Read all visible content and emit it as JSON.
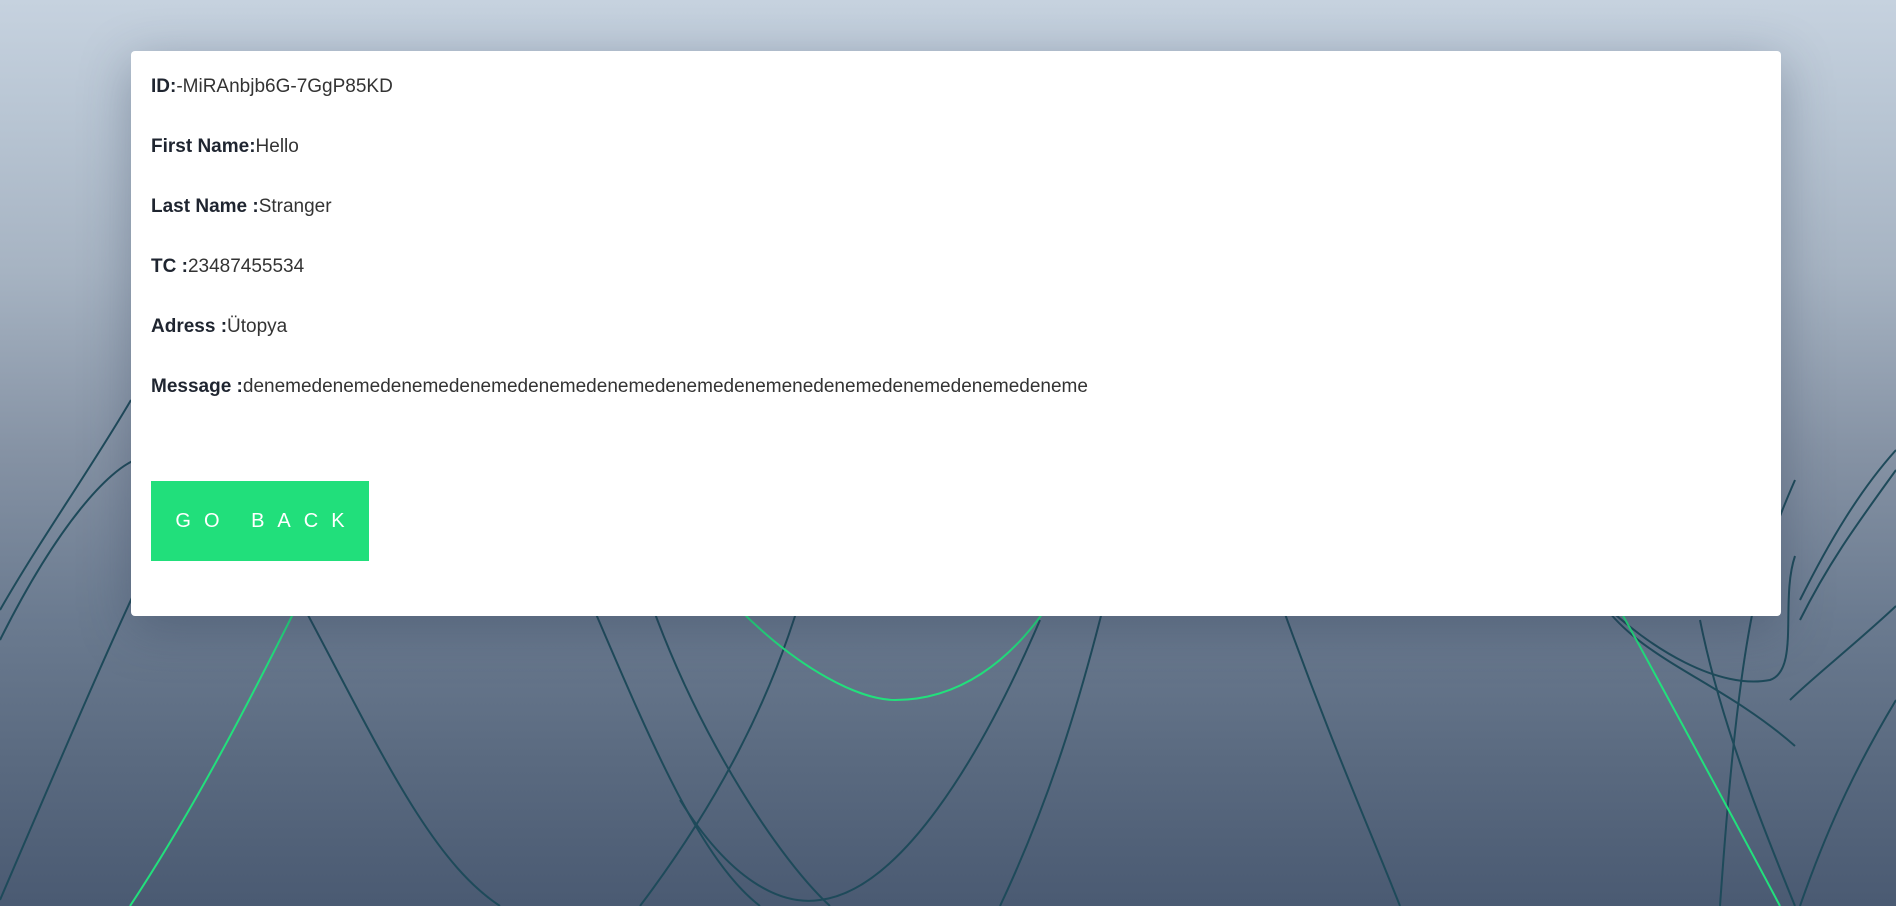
{
  "record": {
    "id_label": "ID:",
    "id_value": "-MiRAnbjb6G-7GgP85KD",
    "first_name_label": "First Name:",
    "first_name_value": "Hello",
    "last_name_label": "Last Name :",
    "last_name_value": "Stranger",
    "tc_label": "TC :",
    "tc_value": "23487455534",
    "address_label": "Adress :",
    "address_value": "Ütopya",
    "message_label": "Message :",
    "message_value": "denemedenemedenemedenemedenemedenemedenemedenemenedenemedenemedenemedeneme"
  },
  "actions": {
    "back_label": "GO BACK"
  },
  "colors": {
    "button": "#21df7b",
    "line_dark": "#1e4a5a",
    "line_green": "#22e07c"
  }
}
